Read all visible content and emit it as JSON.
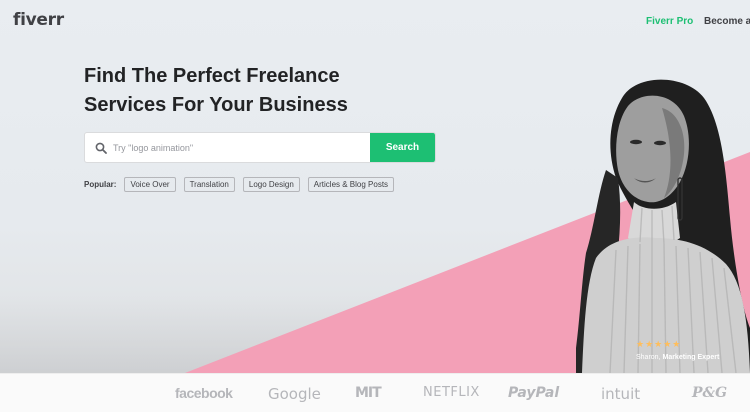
{
  "nav": {
    "logo": "fiverr",
    "pro_label": "Fiverr Pro",
    "become_label": "Become a"
  },
  "hero": {
    "headline_line1": "Find The Perfect Freelance",
    "headline_line2": "Services For Your Business",
    "search": {
      "placeholder": "Try \"logo animation\"",
      "button_label": "Search"
    },
    "popular": {
      "label": "Popular:",
      "tags": [
        "Voice Over",
        "Translation",
        "Logo Design",
        "Articles & Blog Posts"
      ]
    },
    "testimonial": {
      "stars": "★★★★★",
      "name": "Sharon,",
      "role": "Marketing Expert",
      "rating": 5
    }
  },
  "trusted_by": [
    "facebook",
    "Google",
    "MIT",
    "NETFLIX",
    "PayPal",
    "intuit",
    "P&G"
  ],
  "colors": {
    "brand_green": "#1dbf73",
    "accent_pink": "#f3a3b9",
    "text_dark": "#404145",
    "star_gold": "#ffbe5b"
  }
}
